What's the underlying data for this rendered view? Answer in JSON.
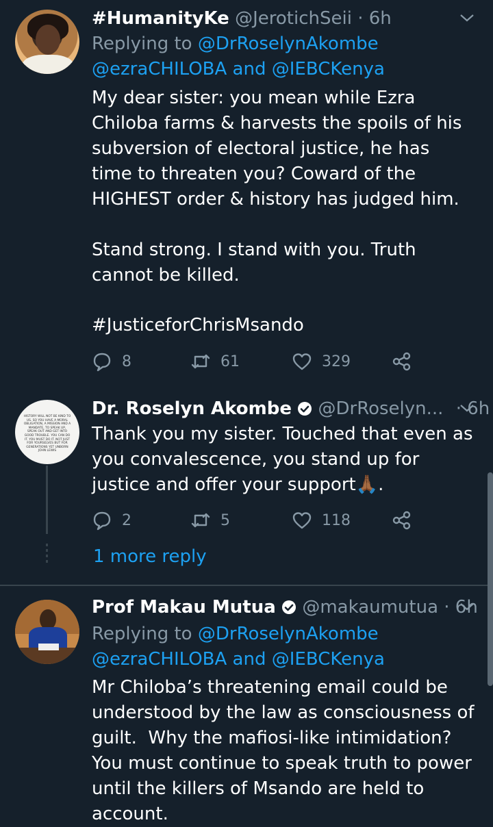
{
  "tweets": [
    {
      "name": "#HumanityKe",
      "handle": "@JerotichSeii",
      "time": "· 6h",
      "replying_prefix": "Replying to ",
      "replying_1": "@DrRoselynAkombe",
      "replying_2": "@ezraCHILOBA",
      "replying_and": " and ",
      "replying_3": "@IEBCKenya",
      "body": "My dear sister: you mean while Ezra Chiloba farms & harvests the spoils of his subversion of electoral justice, he has time to threaten you? Coward of the HIGHEST order & history has judged him.\n\nStand strong. I stand with you. Truth cannot be killed.",
      "hashtag": "#JusticeforChrisMsando",
      "replies": "8",
      "retweets": "61",
      "likes": "329"
    },
    {
      "name": "Dr. Roselyn Akombe",
      "handle": "@DrRoselyn...",
      "time": "· 6h",
      "body": "Thank you my sister. Touched that even as you convalescence, you stand up for justice and offer your support🙏🏾.",
      "replies": "2",
      "retweets": "5",
      "likes": "118",
      "avatar_text": "HISTORY WILL NOT BE KIND TO US. SO YOU HAVE A MORAL OBLIGATION, A MISSION AND A MANDATE, TO SPEAK UP, SPEAK OUT AND GET INTO GOOD TROUBLE. YOU CAN DO IT. YOU MUST DO IT. NOT JUST FOR YOURSELVES BUT FOR GENERATIONS YET UNBORN",
      "avatar_author": "JOHN LEWIS"
    },
    {
      "name": "Prof Makau Mutua",
      "handle": "@makaumutua",
      "time": "· 6h",
      "replying_prefix": "Replying to ",
      "replying_1": "@DrRoselynAkombe",
      "replying_2": "@ezraCHILOBA",
      "replying_and": " and ",
      "replying_3": "@IEBCKenya",
      "body": "Mr Chiloba’s threatening email could be understood by the law as consciousness of guilt.  Why the mafiosi-like intimidation?  You must continue to speak truth to power until the killers of Msando are held to account."
    }
  ],
  "more_reply_label": "1 more reply",
  "icons": {
    "reply": "reply-icon",
    "retweet": "retweet-icon",
    "like": "heart-icon",
    "share": "share-icon",
    "chevron": "chevron-down-icon",
    "verified": "verified-badge-icon"
  },
  "colors": {
    "background": "#15202b",
    "link": "#1da1f2",
    "secondary_text": "#8899a6",
    "divider": "#38444d"
  }
}
